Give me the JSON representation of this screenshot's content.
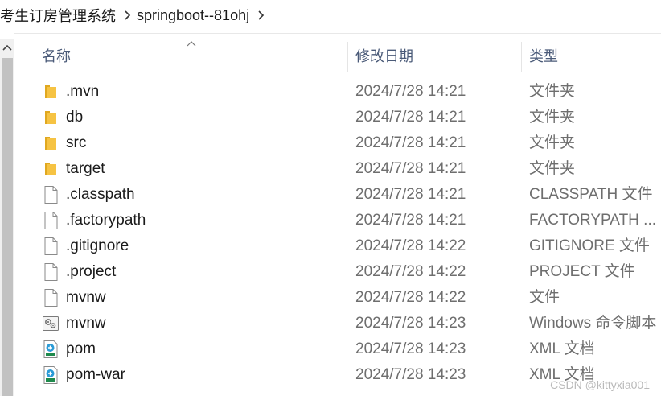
{
  "breadcrumb": {
    "items": [
      "考生订房管理系统",
      "springboot--81ohj"
    ]
  },
  "columns": {
    "name": "名称",
    "date": "修改日期",
    "type": "类型"
  },
  "files": [
    {
      "name": ".mvn",
      "date": "2024/7/28 14:21",
      "type": "文件夹",
      "icon": "folder-icon"
    },
    {
      "name": "db",
      "date": "2024/7/28 14:21",
      "type": "文件夹",
      "icon": "folder-icon"
    },
    {
      "name": "src",
      "date": "2024/7/28 14:21",
      "type": "文件夹",
      "icon": "folder-icon"
    },
    {
      "name": "target",
      "date": "2024/7/28 14:21",
      "type": "文件夹",
      "icon": "folder-icon"
    },
    {
      "name": ".classpath",
      "date": "2024/7/28 14:21",
      "type": "CLASSPATH 文件",
      "icon": "file-icon"
    },
    {
      "name": ".factorypath",
      "date": "2024/7/28 14:21",
      "type": "FACTORYPATH ...",
      "icon": "file-icon"
    },
    {
      "name": ".gitignore",
      "date": "2024/7/28 14:22",
      "type": "GITIGNORE 文件",
      "icon": "file-icon"
    },
    {
      "name": ".project",
      "date": "2024/7/28 14:22",
      "type": "PROJECT 文件",
      "icon": "file-icon"
    },
    {
      "name": "mvnw",
      "date": "2024/7/28 14:22",
      "type": "文件",
      "icon": "file-icon"
    },
    {
      "name": "mvnw",
      "date": "2024/7/28 14:23",
      "type": "Windows 命令脚本",
      "icon": "script-file-icon"
    },
    {
      "name": "pom",
      "date": "2024/7/28 14:23",
      "type": "XML 文档",
      "icon": "xml-file-icon"
    },
    {
      "name": "pom-war",
      "date": "2024/7/28 14:23",
      "type": "XML 文档",
      "icon": "xml-file-icon"
    }
  ],
  "watermark": "CSDN @kittyxia001",
  "colors": {
    "folder": "#f6c343",
    "header_text": "#4a5a78",
    "secondary_text": "#6e6e6e"
  }
}
